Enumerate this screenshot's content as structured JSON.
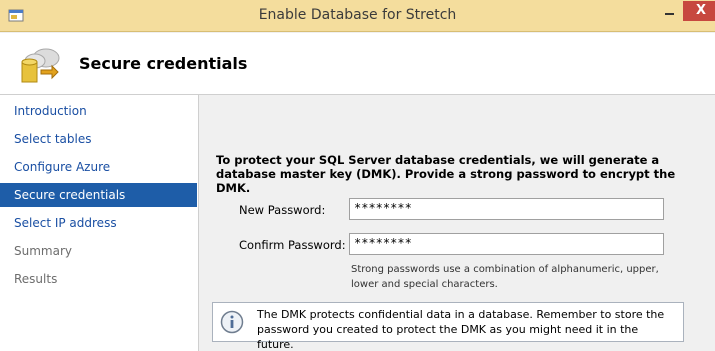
{
  "window": {
    "title": "Enable Database for Stretch",
    "close_label": "X"
  },
  "header": {
    "title": "Secure credentials"
  },
  "sidebar": {
    "items": [
      {
        "label": "Introduction"
      },
      {
        "label": "Select tables"
      },
      {
        "label": "Configure Azure"
      },
      {
        "label": "Secure credentials"
      },
      {
        "label": "Select IP address"
      },
      {
        "label": "Summary"
      },
      {
        "label": "Results"
      }
    ],
    "active_item": "Secure credentials"
  },
  "main": {
    "intro": "To protect your SQL Server database credentials, we will generate a database master key (DMK). Provide a strong password to encrypt the DMK.",
    "new_password_label": "New Password:",
    "new_password_value": "********",
    "confirm_password_label": "Confirm Password:",
    "confirm_password_value": "********",
    "help_text": "Strong passwords use a combination of alphanumeric, upper, lower and special characters.",
    "info_text": "The DMK protects confidential data in a database. Remember to store the password you created to protect the DMK as you might need it in the future."
  },
  "colors": {
    "titlebar": "#f4dd9d",
    "close_button": "#c7483f",
    "active_nav": "#1e5da8",
    "link": "#1a4fa3"
  },
  "icons": {
    "window": "window-app-icon",
    "header": "cloud-database-icon",
    "info": "info-icon"
  }
}
